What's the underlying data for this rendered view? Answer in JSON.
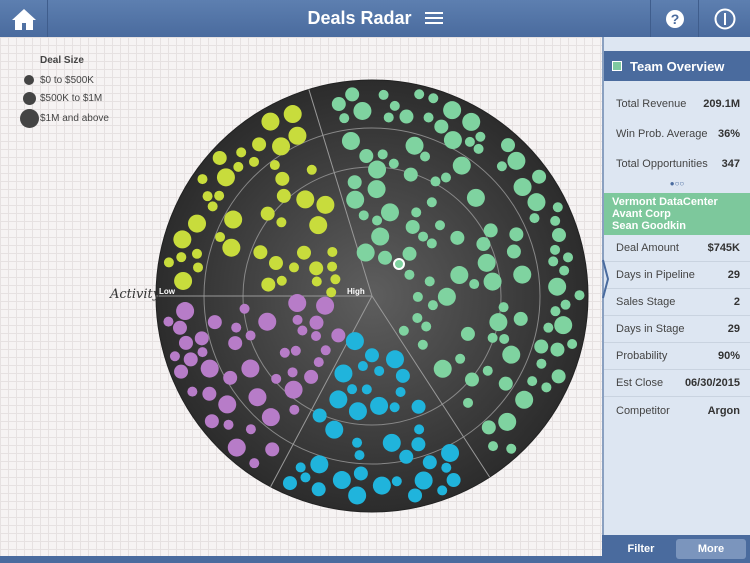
{
  "app": {
    "title": "Deals Radar"
  },
  "legend": {
    "title": "Deal Size",
    "items": [
      "$0 to $500K",
      "$500K to $1M",
      "$1M and above"
    ]
  },
  "radar": {
    "axis_label": "Activity",
    "low_label": "Low",
    "high_label": "High",
    "colors": {
      "yellow": "#c8dc3c",
      "green": "#7fd3a0",
      "purple": "#b77cc8",
      "cyan": "#20b4dc",
      "selected": "#7fd3a0"
    }
  },
  "team": {
    "title": "Team Overview",
    "stats": [
      {
        "label": "Total Revenue",
        "value": "209.1M"
      },
      {
        "label": "Win Prob. Average",
        "value": "36%"
      },
      {
        "label": "Total Opportunities",
        "value": "347"
      }
    ],
    "page_dots": "●○○"
  },
  "deal": {
    "name": "Vermont DataCenter",
    "company": "Avant Corp",
    "owner": "Sean Goodkin",
    "fields": [
      {
        "label": "Deal Amount",
        "value": "$745K"
      },
      {
        "label": "Days in Pipeline",
        "value": "29"
      },
      {
        "label": "Sales Stage",
        "value": "2"
      },
      {
        "label": "Days in Stage",
        "value": "29"
      },
      {
        "label": "Probability",
        "value": "90%"
      },
      {
        "label": "Est Close",
        "value": "06/30/2015"
      },
      {
        "label": "Competitor",
        "value": "Argon"
      }
    ]
  },
  "buttons": {
    "filter": "Filter",
    "more": "More"
  }
}
